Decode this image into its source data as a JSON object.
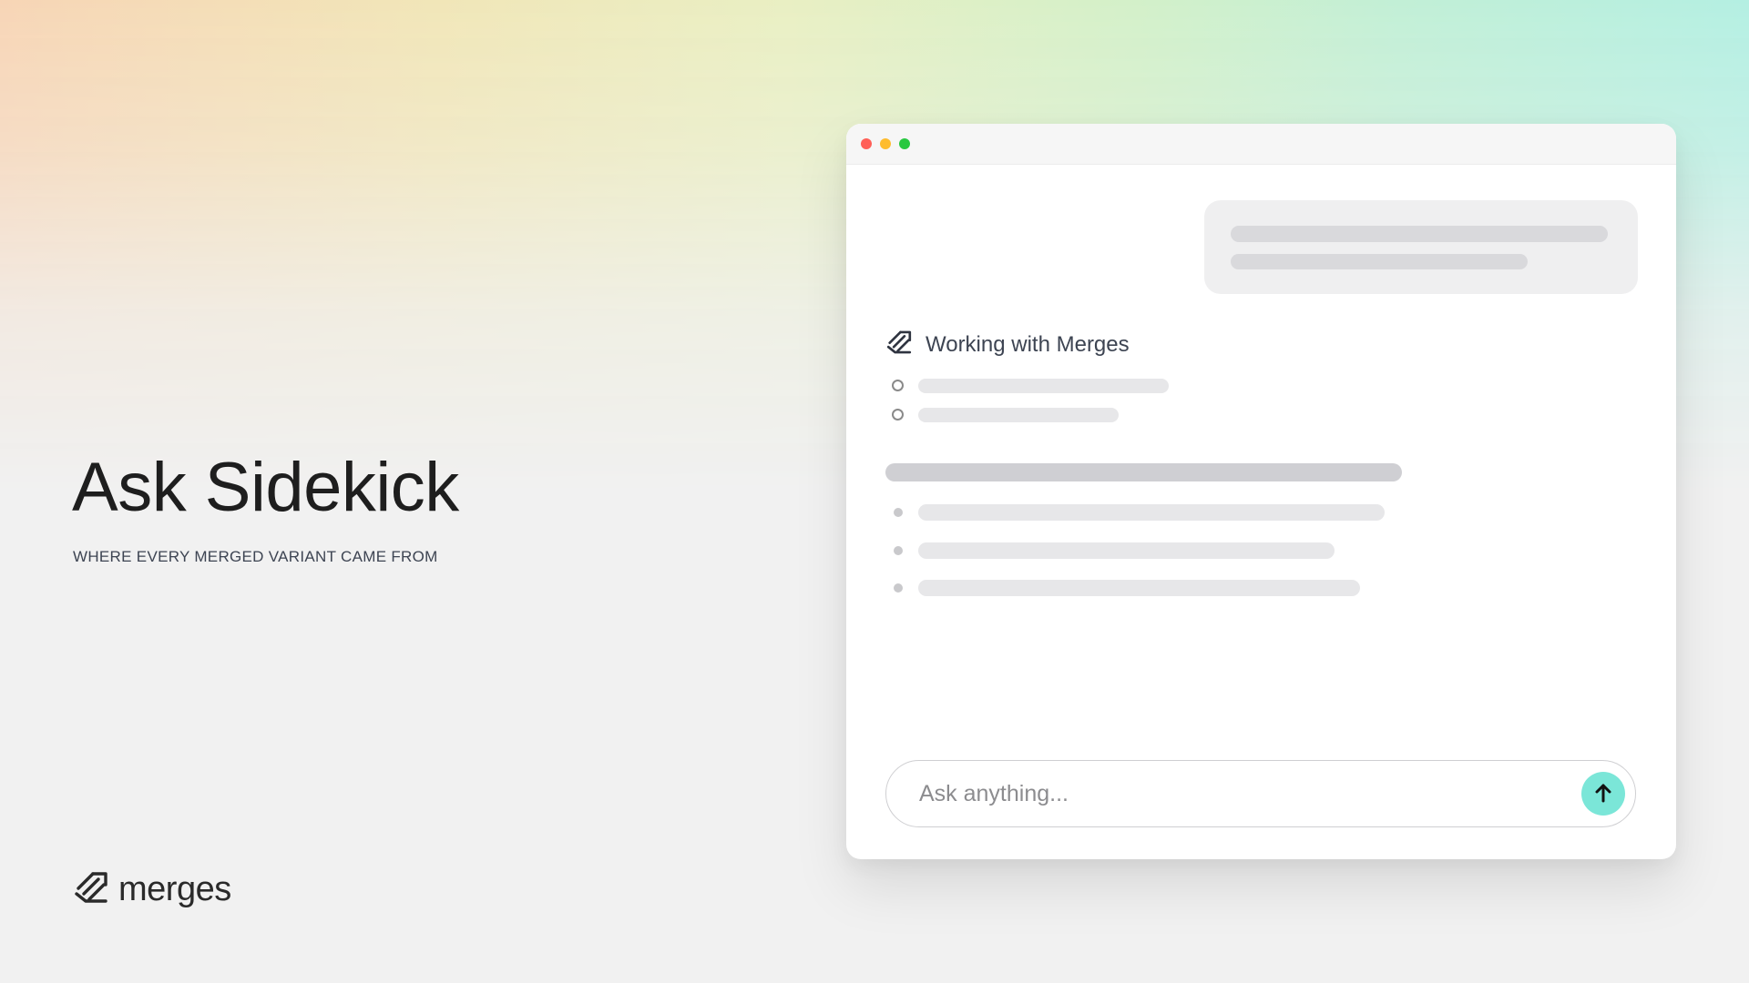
{
  "colors": {
    "accent": "#7be6d8",
    "close_dot": "#ff5f57",
    "minimize_dot": "#febc2e",
    "zoom_dot": "#28c840",
    "placeholder_bar": "#e7e7e9",
    "heading_bar": "#cfcfd3"
  },
  "hero": {
    "title": "Ask Sidekick",
    "subtitle": "WHERE EVERY MERGED VARIANT CAME FROM"
  },
  "brand": {
    "name": "merges",
    "logo_icon": "merges-logo-icon"
  },
  "window": {
    "controls": [
      "close",
      "minimize",
      "zoom"
    ]
  },
  "chat": {
    "agent_title": "Working with Merges",
    "agent_icon": "merges-logo-icon"
  },
  "composer": {
    "placeholder": "Ask anything...",
    "send_icon": "arrow-up-icon"
  }
}
